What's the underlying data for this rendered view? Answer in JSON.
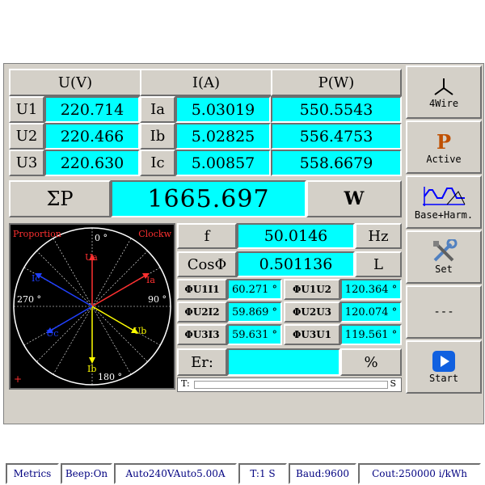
{
  "headers": {
    "voltage": "U(V)",
    "current": "I(A)",
    "power": "P(W)"
  },
  "rows": [
    {
      "u_label": "U1",
      "u_value": "220.714",
      "i_label": "Ia",
      "i_value": "5.03019",
      "p_value": "550.5543"
    },
    {
      "u_label": "U2",
      "u_value": "220.466",
      "i_label": "Ib",
      "i_value": "5.02825",
      "p_value": "556.4753"
    },
    {
      "u_label": "U3",
      "u_value": "220.630",
      "i_label": "Ic",
      "i_value": "5.00857",
      "p_value": "558.6679"
    }
  ],
  "total": {
    "label": "ΣP",
    "value": "1665.697",
    "unit": "W"
  },
  "frequency": {
    "label": "f",
    "value": "50.0146",
    "unit": "Hz"
  },
  "power_factor": {
    "label": "CosΦ",
    "value": "0.501136",
    "unit": "L"
  },
  "phases": [
    {
      "label": "ΦU1I1",
      "value": "60.271 °",
      "label2": "ΦU1U2",
      "value2": "120.364 °"
    },
    {
      "label": "ΦU2I2",
      "value": "59.869 °",
      "label2": "ΦU2U3",
      "value2": "120.074 °"
    },
    {
      "label": "ΦU3I3",
      "value": "59.631 °",
      "label2": "ΦU3U1",
      "value2": "119.561 °"
    }
  ],
  "error": {
    "label": "Er:",
    "value": "",
    "unit": "%"
  },
  "time_bar": {
    "left": "T:",
    "right": "S"
  },
  "vector_diagram": {
    "mode_left": "Proportion",
    "mode_right": "Clockw",
    "angle_0": "0 °",
    "angle_90": "90 °",
    "angle_180": "180 °",
    "angle_270": "270 °",
    "plus": "+",
    "labels": {
      "ua": "Ua",
      "ub": "Ub",
      "uc": "Uc",
      "ia": "Ia",
      "ib": "Ib",
      "ic": "Ic"
    },
    "colors": {
      "a": "#ff3030",
      "b": "#ffff00",
      "c": "#2040ff",
      "frame": "#ffffff"
    }
  },
  "side_buttons": [
    {
      "label": "4Wire",
      "icon": "wye-connection-icon"
    },
    {
      "label": "Active",
      "icon": "P",
      "icon_color": "#c05000"
    },
    {
      "label": "Base+Harm.",
      "icon": "waveform-icon"
    },
    {
      "label": "Set",
      "icon": "tools-icon"
    },
    {
      "label": "---",
      "icon": ""
    },
    {
      "label": "Start",
      "icon": "play-icon",
      "icon_color": "#1060e0"
    }
  ],
  "status_bar": [
    "Metrics",
    "Beep:On",
    "Auto240VAuto5.00A",
    "T:1 S",
    "Baud:9600",
    "Cout:250000 i/kWh"
  ]
}
